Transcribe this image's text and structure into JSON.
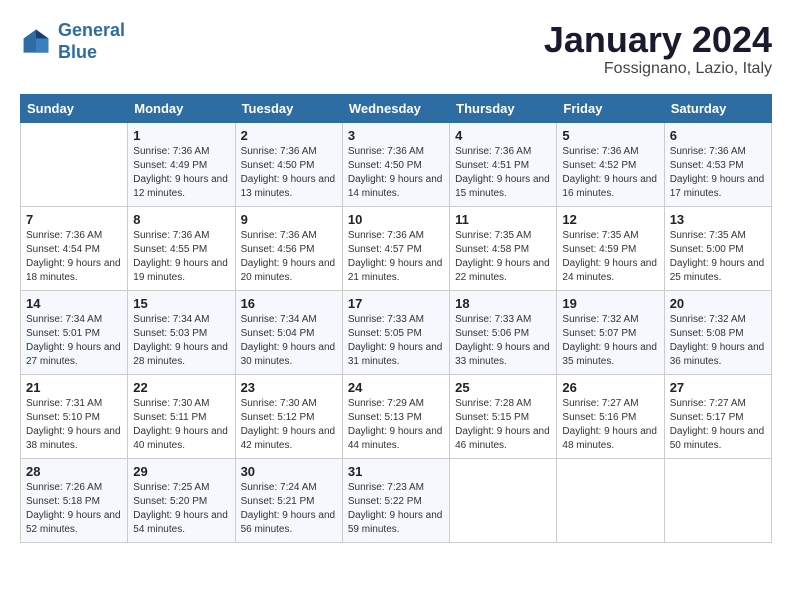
{
  "logo": {
    "line1": "General",
    "line2": "Blue"
  },
  "title": "January 2024",
  "subtitle": "Fossignano, Lazio, Italy",
  "days_header": [
    "Sunday",
    "Monday",
    "Tuesday",
    "Wednesday",
    "Thursday",
    "Friday",
    "Saturday"
  ],
  "weeks": [
    [
      {
        "day": "",
        "sunrise": "",
        "sunset": "",
        "daylight": ""
      },
      {
        "day": "1",
        "sunrise": "Sunrise: 7:36 AM",
        "sunset": "Sunset: 4:49 PM",
        "daylight": "Daylight: 9 hours and 12 minutes."
      },
      {
        "day": "2",
        "sunrise": "Sunrise: 7:36 AM",
        "sunset": "Sunset: 4:50 PM",
        "daylight": "Daylight: 9 hours and 13 minutes."
      },
      {
        "day": "3",
        "sunrise": "Sunrise: 7:36 AM",
        "sunset": "Sunset: 4:50 PM",
        "daylight": "Daylight: 9 hours and 14 minutes."
      },
      {
        "day": "4",
        "sunrise": "Sunrise: 7:36 AM",
        "sunset": "Sunset: 4:51 PM",
        "daylight": "Daylight: 9 hours and 15 minutes."
      },
      {
        "day": "5",
        "sunrise": "Sunrise: 7:36 AM",
        "sunset": "Sunset: 4:52 PM",
        "daylight": "Daylight: 9 hours and 16 minutes."
      },
      {
        "day": "6",
        "sunrise": "Sunrise: 7:36 AM",
        "sunset": "Sunset: 4:53 PM",
        "daylight": "Daylight: 9 hours and 17 minutes."
      }
    ],
    [
      {
        "day": "7",
        "sunrise": "Sunrise: 7:36 AM",
        "sunset": "Sunset: 4:54 PM",
        "daylight": "Daylight: 9 hours and 18 minutes."
      },
      {
        "day": "8",
        "sunrise": "Sunrise: 7:36 AM",
        "sunset": "Sunset: 4:55 PM",
        "daylight": "Daylight: 9 hours and 19 minutes."
      },
      {
        "day": "9",
        "sunrise": "Sunrise: 7:36 AM",
        "sunset": "Sunset: 4:56 PM",
        "daylight": "Daylight: 9 hours and 20 minutes."
      },
      {
        "day": "10",
        "sunrise": "Sunrise: 7:36 AM",
        "sunset": "Sunset: 4:57 PM",
        "daylight": "Daylight: 9 hours and 21 minutes."
      },
      {
        "day": "11",
        "sunrise": "Sunrise: 7:35 AM",
        "sunset": "Sunset: 4:58 PM",
        "daylight": "Daylight: 9 hours and 22 minutes."
      },
      {
        "day": "12",
        "sunrise": "Sunrise: 7:35 AM",
        "sunset": "Sunset: 4:59 PM",
        "daylight": "Daylight: 9 hours and 24 minutes."
      },
      {
        "day": "13",
        "sunrise": "Sunrise: 7:35 AM",
        "sunset": "Sunset: 5:00 PM",
        "daylight": "Daylight: 9 hours and 25 minutes."
      }
    ],
    [
      {
        "day": "14",
        "sunrise": "Sunrise: 7:34 AM",
        "sunset": "Sunset: 5:01 PM",
        "daylight": "Daylight: 9 hours and 27 minutes."
      },
      {
        "day": "15",
        "sunrise": "Sunrise: 7:34 AM",
        "sunset": "Sunset: 5:03 PM",
        "daylight": "Daylight: 9 hours and 28 minutes."
      },
      {
        "day": "16",
        "sunrise": "Sunrise: 7:34 AM",
        "sunset": "Sunset: 5:04 PM",
        "daylight": "Daylight: 9 hours and 30 minutes."
      },
      {
        "day": "17",
        "sunrise": "Sunrise: 7:33 AM",
        "sunset": "Sunset: 5:05 PM",
        "daylight": "Daylight: 9 hours and 31 minutes."
      },
      {
        "day": "18",
        "sunrise": "Sunrise: 7:33 AM",
        "sunset": "Sunset: 5:06 PM",
        "daylight": "Daylight: 9 hours and 33 minutes."
      },
      {
        "day": "19",
        "sunrise": "Sunrise: 7:32 AM",
        "sunset": "Sunset: 5:07 PM",
        "daylight": "Daylight: 9 hours and 35 minutes."
      },
      {
        "day": "20",
        "sunrise": "Sunrise: 7:32 AM",
        "sunset": "Sunset: 5:08 PM",
        "daylight": "Daylight: 9 hours and 36 minutes."
      }
    ],
    [
      {
        "day": "21",
        "sunrise": "Sunrise: 7:31 AM",
        "sunset": "Sunset: 5:10 PM",
        "daylight": "Daylight: 9 hours and 38 minutes."
      },
      {
        "day": "22",
        "sunrise": "Sunrise: 7:30 AM",
        "sunset": "Sunset: 5:11 PM",
        "daylight": "Daylight: 9 hours and 40 minutes."
      },
      {
        "day": "23",
        "sunrise": "Sunrise: 7:30 AM",
        "sunset": "Sunset: 5:12 PM",
        "daylight": "Daylight: 9 hours and 42 minutes."
      },
      {
        "day": "24",
        "sunrise": "Sunrise: 7:29 AM",
        "sunset": "Sunset: 5:13 PM",
        "daylight": "Daylight: 9 hours and 44 minutes."
      },
      {
        "day": "25",
        "sunrise": "Sunrise: 7:28 AM",
        "sunset": "Sunset: 5:15 PM",
        "daylight": "Daylight: 9 hours and 46 minutes."
      },
      {
        "day": "26",
        "sunrise": "Sunrise: 7:27 AM",
        "sunset": "Sunset: 5:16 PM",
        "daylight": "Daylight: 9 hours and 48 minutes."
      },
      {
        "day": "27",
        "sunrise": "Sunrise: 7:27 AM",
        "sunset": "Sunset: 5:17 PM",
        "daylight": "Daylight: 9 hours and 50 minutes."
      }
    ],
    [
      {
        "day": "28",
        "sunrise": "Sunrise: 7:26 AM",
        "sunset": "Sunset: 5:18 PM",
        "daylight": "Daylight: 9 hours and 52 minutes."
      },
      {
        "day": "29",
        "sunrise": "Sunrise: 7:25 AM",
        "sunset": "Sunset: 5:20 PM",
        "daylight": "Daylight: 9 hours and 54 minutes."
      },
      {
        "day": "30",
        "sunrise": "Sunrise: 7:24 AM",
        "sunset": "Sunset: 5:21 PM",
        "daylight": "Daylight: 9 hours and 56 minutes."
      },
      {
        "day": "31",
        "sunrise": "Sunrise: 7:23 AM",
        "sunset": "Sunset: 5:22 PM",
        "daylight": "Daylight: 9 hours and 59 minutes."
      },
      {
        "day": "",
        "sunrise": "",
        "sunset": "",
        "daylight": ""
      },
      {
        "day": "",
        "sunrise": "",
        "sunset": "",
        "daylight": ""
      },
      {
        "day": "",
        "sunrise": "",
        "sunset": "",
        "daylight": ""
      }
    ]
  ]
}
